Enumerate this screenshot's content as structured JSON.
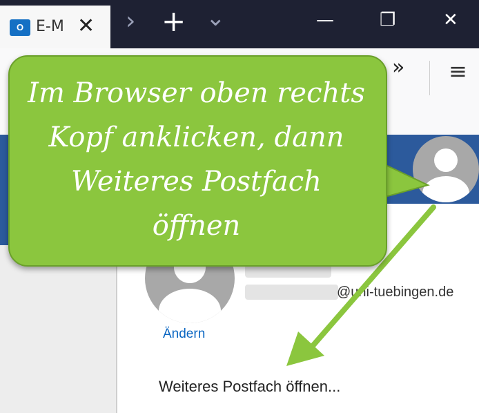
{
  "browser": {
    "tab_icon_text": "O",
    "tab_title": "E-M",
    "tab_close": "✕",
    "tab_scroll": "›",
    "new_tab": "+",
    "tab_list": "⌄",
    "minimize": "—",
    "restore": "❐",
    "close": "✕",
    "overflow": "»",
    "menu": "≡"
  },
  "account": {
    "email_domain": "@uni-tuebingen.de",
    "change_link": "Ändern",
    "open_mailbox": "Weiteres Postfach öffnen..."
  },
  "callout": {
    "text": "Im Browser oben rechts\nKopf anklicken, dann\nWeiteres Postfach\nöffnen",
    "color": "#8bc63e"
  },
  "colors": {
    "header_blue": "#2c5a9c",
    "titlebar": "#1e2133",
    "link": "#0a66c2"
  }
}
